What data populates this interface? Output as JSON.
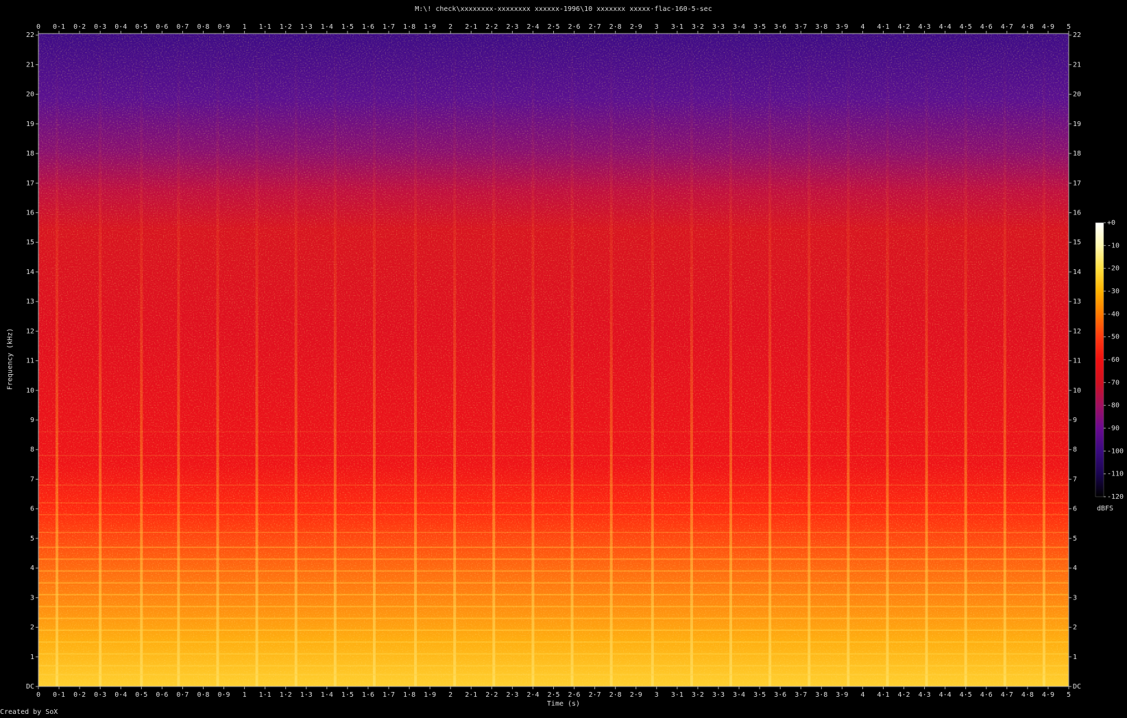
{
  "page": {
    "footer": "Created by SoX"
  },
  "chart_data": {
    "type": "heatmap",
    "title": "M:\\! check\\xxxxxxxx-xxxxxxxx xxxxxx-1996\\10 xxxxxxx xxxxx·flac-160-5-sec",
    "xlabel": "Time (s)",
    "ylabel": "Frequency (kHz)",
    "xlim": [
      0,
      5
    ],
    "ylim": [
      0,
      22.05
    ],
    "x_ticks": [
      "0",
      "0·1",
      "0·2",
      "0·3",
      "0·4",
      "0·5",
      "0·6",
      "0·7",
      "0·8",
      "0·9",
      "1",
      "1·1",
      "1·2",
      "1·3",
      "1·4",
      "1·5",
      "1·6",
      "1·7",
      "1·8",
      "1·9",
      "2",
      "2·1",
      "2·2",
      "2·3",
      "2·4",
      "2·5",
      "2·6",
      "2·7",
      "2·8",
      "2·9",
      "3",
      "3·1",
      "3·2",
      "3·3",
      "3·4",
      "3·5",
      "3·6",
      "3·7",
      "3·8",
      "3·9",
      "4",
      "4·1",
      "4·2",
      "4·3",
      "4·4",
      "4·5",
      "4·6",
      "4·7",
      "4·8",
      "4·9",
      "5"
    ],
    "y_ticks": [
      "DC",
      "1",
      "2",
      "3",
      "4",
      "5",
      "6",
      "7",
      "8",
      "9",
      "10",
      "11",
      "12",
      "13",
      "14",
      "15",
      "16",
      "17",
      "18",
      "19",
      "20",
      "21",
      "22"
    ],
    "colorbar": {
      "label": "dBFS",
      "range": [
        -120,
        0
      ],
      "ticks": [
        "+0",
        "-10",
        "-20",
        "-30",
        "-40",
        "-50",
        "-60",
        "-70",
        "-80",
        "-90",
        "-100",
        "-110",
        "-120"
      ],
      "stops": [
        "#000000",
        "#1a0550",
        "#3a0a80",
        "#6a0a90",
        "#a01060",
        "#d01020",
        "#f01010",
        "#ff3a10",
        "#ff7a00",
        "#ffb300",
        "#ffe040",
        "#fff8b0",
        "#ffffff"
      ]
    },
    "onsets_s": [
      0.09,
      0.3,
      0.5,
      0.68,
      0.87,
      1.06,
      1.25,
      1.44,
      1.63,
      1.83,
      2.02,
      2.21,
      2.4,
      2.59,
      2.78,
      2.98,
      3.17,
      3.36,
      3.55,
      3.74,
      3.93,
      4.12,
      4.31,
      4.5,
      4.69,
      4.88
    ],
    "harmonics_khz": [
      0.4,
      0.7,
      1.1,
      1.5,
      1.9,
      2.3,
      2.7,
      3.1,
      3.5,
      3.9,
      4.3,
      4.7,
      5.2,
      5.8,
      6.2,
      6.8,
      7.8,
      8.6
    ],
    "energy_profile": [
      {
        "freq_khz": 0,
        "dbfs": -15
      },
      {
        "freq_khz": 2,
        "dbfs": -22
      },
      {
        "freq_khz": 4,
        "dbfs": -28
      },
      {
        "freq_khz": 6,
        "dbfs": -33
      },
      {
        "freq_khz": 7,
        "dbfs": -42
      },
      {
        "freq_khz": 9,
        "dbfs": -48
      },
      {
        "freq_khz": 12,
        "dbfs": -52
      },
      {
        "freq_khz": 15,
        "dbfs": -55
      },
      {
        "freq_khz": 16.5,
        "dbfs": -60
      },
      {
        "freq_khz": 17.5,
        "dbfs": -70
      },
      {
        "freq_khz": 19,
        "dbfs": -82
      },
      {
        "freq_khz": 22.05,
        "dbfs": -88
      }
    ]
  }
}
